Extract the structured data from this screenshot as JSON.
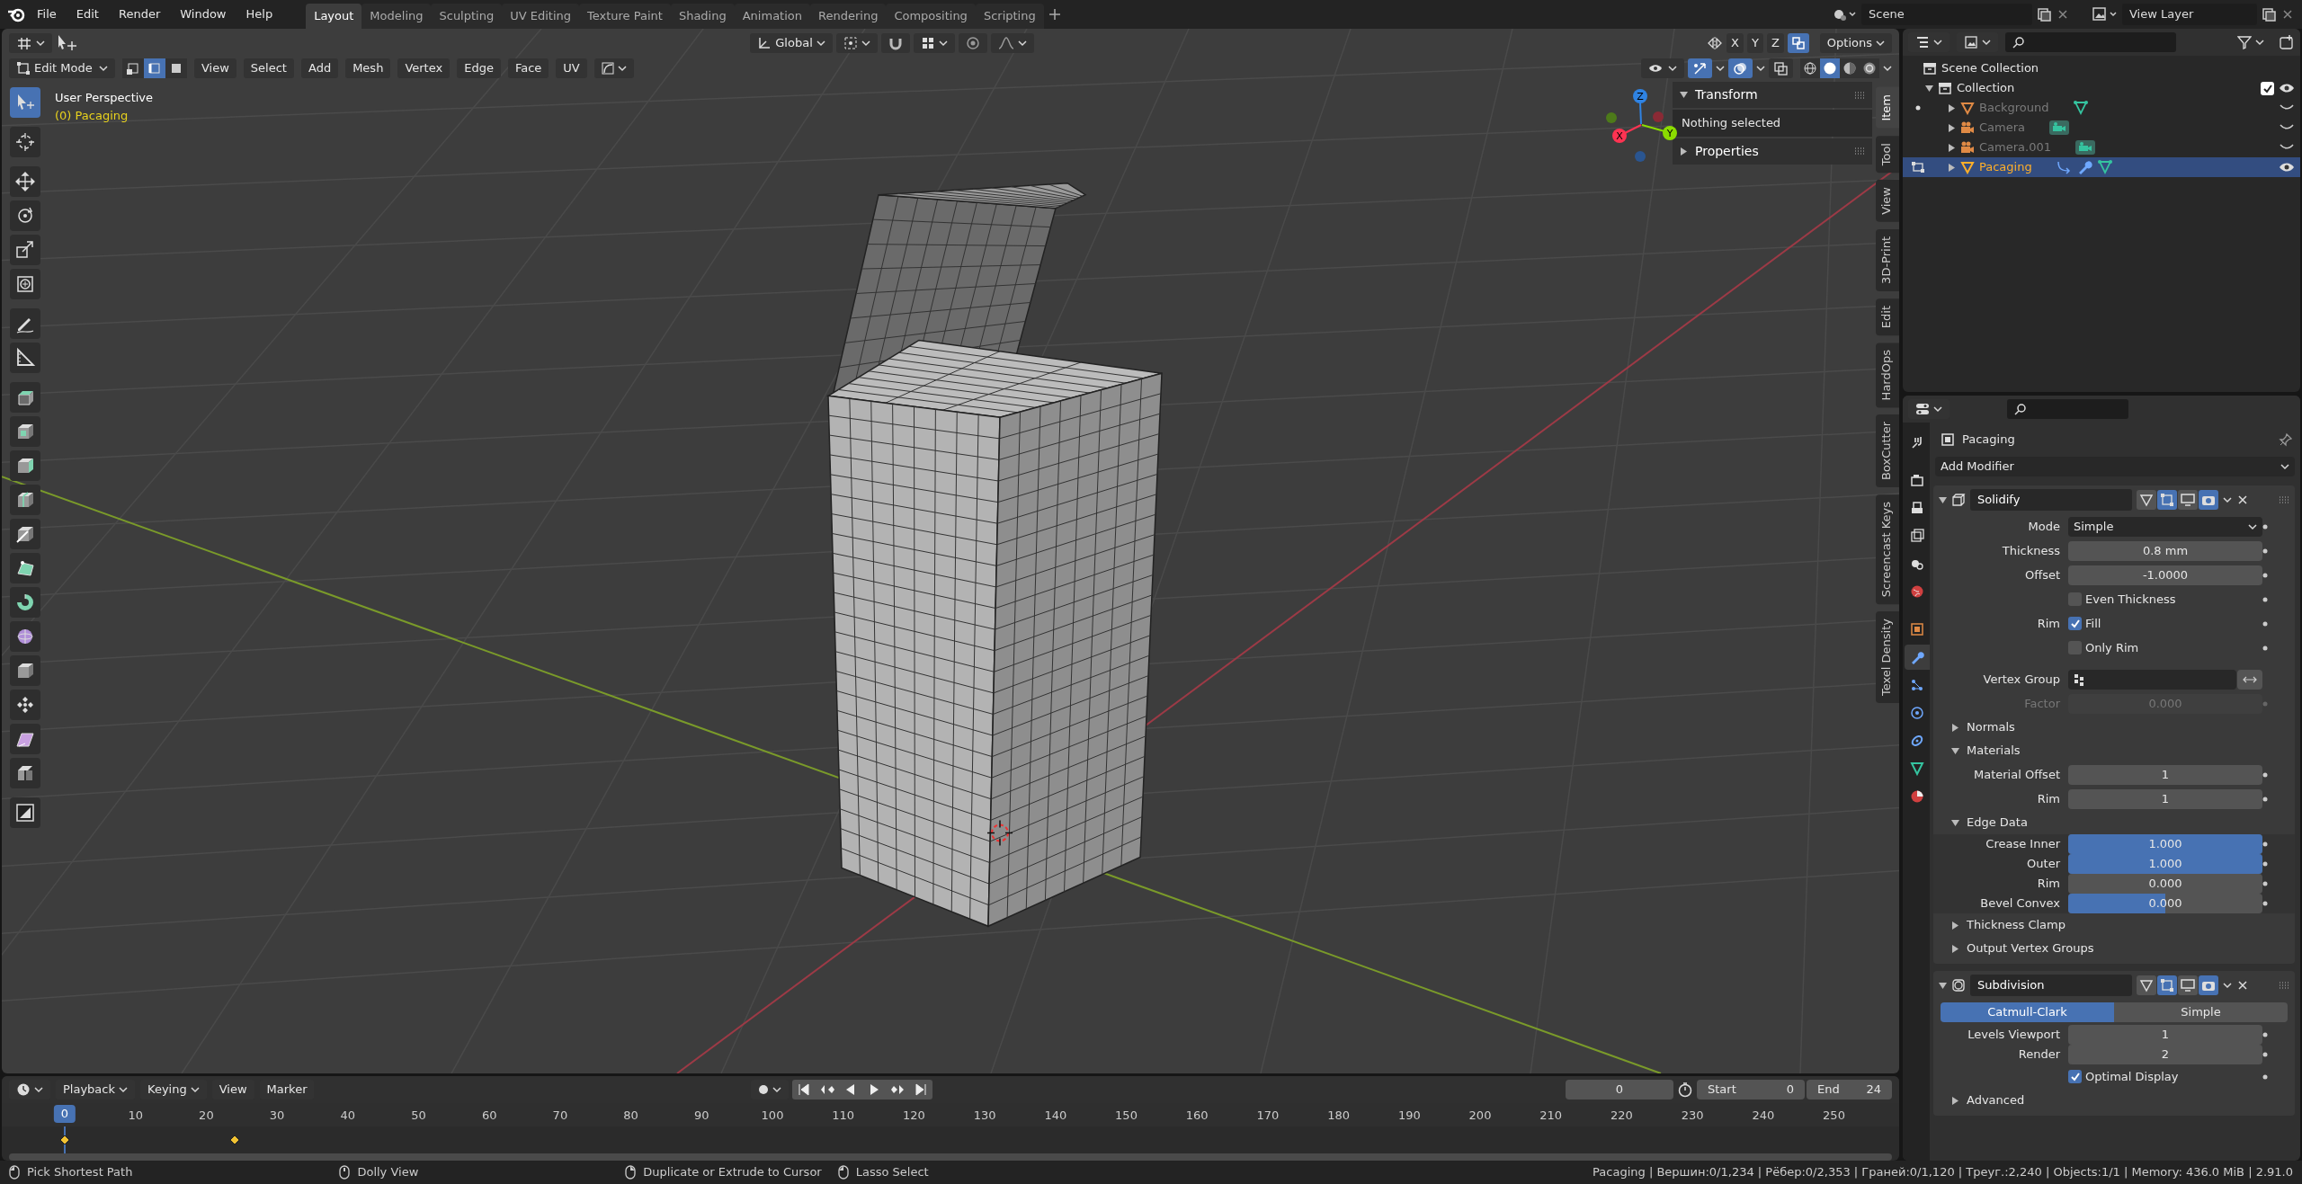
{
  "menu": [
    "File",
    "Edit",
    "Render",
    "Window",
    "Help"
  ],
  "workspaces": [
    {
      "label": "Layout",
      "selected": true
    },
    {
      "label": "Modeling",
      "selected": false
    },
    {
      "label": "Sculpting",
      "selected": false
    },
    {
      "label": "UV Editing",
      "selected": false
    },
    {
      "label": "Texture Paint",
      "selected": false
    },
    {
      "label": "Shading",
      "selected": false
    },
    {
      "label": "Animation",
      "selected": false
    },
    {
      "label": "Rendering",
      "selected": false
    },
    {
      "label": "Compositing",
      "selected": false
    },
    {
      "label": "Scripting",
      "selected": false
    }
  ],
  "scene": "Scene",
  "view_layer": "View Layer",
  "header": {
    "orientation": "Global",
    "mirror_axes": [
      "X",
      "Y",
      "Z"
    ],
    "auto_merge": {
      "on": true
    },
    "snap": {
      "on": false
    },
    "proportional": {
      "on": false
    },
    "options": "Options"
  },
  "mode_bar": {
    "mode": "Edit Mode",
    "select_modes": [
      {
        "kind": "vertex",
        "selected": false
      },
      {
        "kind": "edge",
        "selected": true
      },
      {
        "kind": "face",
        "selected": false
      }
    ],
    "menus": [
      "View",
      "Select",
      "Add",
      "Mesh",
      "Vertex",
      "Edge",
      "Face",
      "UV"
    ]
  },
  "overlays": [
    {
      "kind": "gizmo",
      "on": true
    },
    {
      "kind": "overlay",
      "on": true
    },
    {
      "kind": "xray",
      "on": false
    }
  ],
  "shading": [
    {
      "kind": "wireframe",
      "selected": false
    },
    {
      "kind": "solid",
      "selected": true
    },
    {
      "kind": "material",
      "selected": false
    },
    {
      "kind": "rendered",
      "selected": false
    }
  ],
  "viewport": {
    "title": "User Perspective",
    "object": "(0) Pacaging"
  },
  "gizmo": {
    "x": "X",
    "y": "Y",
    "z": "Z"
  },
  "tool_groups": [
    [
      {
        "kind": "select",
        "selected": true
      }
    ],
    [
      {
        "kind": "cursor",
        "selected": false
      }
    ],
    [
      {
        "kind": "move",
        "selected": false
      },
      {
        "kind": "rotate",
        "selected": false
      },
      {
        "kind": "scale",
        "selected": false
      },
      {
        "kind": "transform",
        "selected": false
      }
    ],
    [
      {
        "kind": "annotate",
        "selected": false
      },
      {
        "kind": "measure",
        "selected": false
      }
    ],
    [
      {
        "kind": "extrude",
        "selected": false
      },
      {
        "kind": "inset",
        "selected": false
      },
      {
        "kind": "bevel",
        "selected": false
      },
      {
        "kind": "loopcut",
        "selected": false
      },
      {
        "kind": "knife",
        "selected": false
      },
      {
        "kind": "polybuild",
        "selected": false
      },
      {
        "kind": "spin",
        "selected": false
      },
      {
        "kind": "smooth",
        "selected": false
      },
      {
        "kind": "slide",
        "selected": false
      },
      {
        "kind": "shrink",
        "selected": false
      },
      {
        "kind": "shear",
        "selected": false
      },
      {
        "kind": "rip",
        "selected": false
      }
    ],
    [
      {
        "kind": "uvtool",
        "selected": false
      }
    ]
  ],
  "sidebar": {
    "panels": [
      {
        "title": "Transform",
        "expanded": true,
        "body": "Nothing selected"
      },
      {
        "title": "Properties",
        "expanded": false
      }
    ],
    "tabs": [
      {
        "label": "Item",
        "selected": true
      },
      {
        "label": "Tool",
        "selected": false
      },
      {
        "label": "View",
        "selected": false
      },
      {
        "label": "3D-Print",
        "selected": false
      },
      {
        "label": "Edit",
        "selected": false
      },
      {
        "label": "HardOps",
        "selected": false
      },
      {
        "label": "BoxCutter",
        "selected": false
      },
      {
        "label": "Screencast Keys",
        "selected": false
      },
      {
        "label": "Texel Density",
        "selected": false
      }
    ]
  },
  "outliner": {
    "root": "Scene Collection",
    "collections": [
      {
        "label": "Collection",
        "expanded": true,
        "checked": true,
        "objects": [
          {
            "label": "Background",
            "kind": "mesh",
            "hidden": true,
            "selected": false,
            "expanded": false,
            "edit_mode": false
          },
          {
            "label": "Camera",
            "kind": "camera",
            "hidden": true,
            "selected": false,
            "expanded": false,
            "edit_mode": false
          },
          {
            "label": "Camera.001",
            "kind": "camera",
            "hidden": true,
            "selected": false,
            "expanded": false,
            "edit_mode": false
          },
          {
            "label": "Pacaging",
            "kind": "mesh_modified",
            "hidden": false,
            "selected": true,
            "expanded": false,
            "edit_mode": true
          }
        ]
      }
    ]
  },
  "properties": {
    "tabs": [
      {
        "kind": "tool",
        "selected": false
      },
      {
        "kind": "render",
        "selected": false
      },
      {
        "kind": "output",
        "selected": false
      },
      {
        "kind": "viewlayer",
        "selected": false
      },
      {
        "kind": "scene",
        "selected": false
      },
      {
        "kind": "world",
        "selected": false
      },
      {
        "kind": "object",
        "selected": false
      },
      {
        "kind": "modifiers",
        "selected": true
      },
      {
        "kind": "particles",
        "selected": false
      },
      {
        "kind": "physics",
        "selected": false
      },
      {
        "kind": "constraints",
        "selected": false
      },
      {
        "kind": "data",
        "selected": false
      },
      {
        "kind": "material",
        "selected": false
      }
    ],
    "object": "Pacaging",
    "add_modifier": "Add Modifier",
    "modifiers": [
      {
        "kind": "solidify",
        "name": "Solidify",
        "expanded": true,
        "toggles": [
          {
            "kind": "cage",
            "on": false
          },
          {
            "kind": "edit",
            "on": true
          },
          {
            "kind": "viewport",
            "on": false
          },
          {
            "kind": "render",
            "on": true
          }
        ],
        "rows": [
          {
            "kind": "dropdown",
            "label": "Mode",
            "value": "Simple"
          },
          {
            "kind": "number",
            "label": "Thickness",
            "value": "0.8 mm",
            "disabled": false
          },
          {
            "kind": "number",
            "label": "Offset",
            "value": "-1.0000",
            "disabled": false
          },
          {
            "kind": "checkbox",
            "text": "Even Thickness",
            "checked": false
          },
          {
            "kind": "checkbox",
            "label": "Rim",
            "text": "Fill",
            "checked": true
          },
          {
            "kind": "checkbox",
            "text": "Only Rim",
            "checked": false
          },
          {
            "kind": "vertex_group",
            "label": "Vertex Group"
          },
          {
            "kind": "number",
            "label": "Factor",
            "value": "0.000",
            "disabled": true
          },
          {
            "kind": "section",
            "label": "Normals",
            "expanded": false
          },
          {
            "kind": "section",
            "label": "Materials",
            "expanded": true
          },
          {
            "kind": "number",
            "label": "Material Offset",
            "value": "1",
            "disabled": false
          },
          {
            "kind": "number",
            "label": "Rim",
            "value": "1",
            "disabled": false
          },
          {
            "kind": "section",
            "label": "Edge Data",
            "expanded": true
          },
          {
            "kind": "slider",
            "label": "Crease Inner",
            "value": "1.000",
            "level": 1
          },
          {
            "kind": "slider",
            "label": "Outer",
            "value": "1.000",
            "level": 1
          },
          {
            "kind": "slider",
            "label": "Rim",
            "value": "0.000",
            "level": 0
          },
          {
            "kind": "slider",
            "label": "Bevel Convex",
            "value": "0.000",
            "level": 0.5
          },
          {
            "kind": "section",
            "label": "Thickness Clamp",
            "expanded": false
          },
          {
            "kind": "section",
            "label": "Output Vertex Groups",
            "expanded": false
          }
        ]
      },
      {
        "kind": "subdivision",
        "name": "Subdivision",
        "expanded": true,
        "toggles": [
          {
            "kind": "cage",
            "on": false
          },
          {
            "kind": "edit",
            "on": true
          },
          {
            "kind": "viewport",
            "on": false
          },
          {
            "kind": "render",
            "on": true
          }
        ],
        "rows": [
          {
            "kind": "segmented",
            "options": [
              {
                "label": "Catmull-Clark",
                "selected": true
              },
              {
                "label": "Simple",
                "selected": false
              }
            ]
          },
          {
            "kind": "slim_number",
            "label": "Levels Viewport",
            "value": "1"
          },
          {
            "kind": "slim_number",
            "label": "Render",
            "value": "2"
          },
          {
            "kind": "checkbox",
            "text": "Optimal Display",
            "checked": true
          },
          {
            "kind": "section",
            "label": "Advanced",
            "expanded": false
          }
        ]
      }
    ]
  },
  "timeline": {
    "menus": [
      "Playback",
      "Keying",
      "View",
      "Marker"
    ],
    "frame": "0",
    "start": {
      "label": "Start",
      "value": "0"
    },
    "end": {
      "label": "End",
      "value": "24"
    },
    "playhead": "0",
    "ruler": [
      "10",
      "20",
      "30",
      "40",
      "50",
      "60",
      "70",
      "80",
      "90",
      "100",
      "110",
      "120",
      "130",
      "140",
      "150",
      "160",
      "170",
      "180",
      "190",
      "200",
      "210",
      "220",
      "230",
      "240",
      "250"
    ]
  },
  "status_bar": {
    "hints": [
      "Pick Shortest Path",
      "Dolly View",
      "Duplicate or Extrude to Cursor",
      "Lasso Select"
    ],
    "stats": "Pacaging | Вершин:0/1,234 | Рёбер:0/2,353 | Граней:0/1,120 | Треуг.:2,240 | Objects:1/1 | Memory: 436.0 MiB | 2.91.0"
  }
}
